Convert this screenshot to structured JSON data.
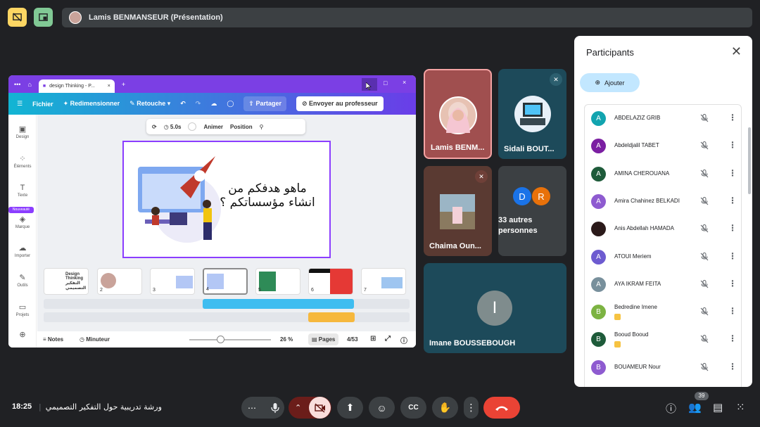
{
  "presenter_chip": {
    "label": "Lamis BENMANSEUR (Présentation)"
  },
  "canva": {
    "tab_title": "design Thinking - P...",
    "menu": {
      "file": "Fichier",
      "resize": "Redimensionner",
      "retouch": "Retouche",
      "share": "Partager",
      "send": "Envoyer au professeur"
    },
    "floatbar": {
      "duration": "5.0s",
      "animate": "Animer",
      "position": "Position"
    },
    "sidebar": [
      {
        "label": "Design",
        "icon": "design-icon"
      },
      {
        "label": "Éléments",
        "icon": "elements-icon"
      },
      {
        "label": "Texte",
        "icon": "text-icon"
      },
      {
        "label": "Marque",
        "icon": "brand-icon"
      },
      {
        "label": "Importer",
        "icon": "upload-icon"
      },
      {
        "label": "Outils",
        "icon": "tools-icon"
      },
      {
        "label": "Projets",
        "icon": "projects-icon"
      }
    ],
    "new_badge": "Nouveauté",
    "slide_text": "ماهو هدفكم من انشاء مؤسساتكم ؟",
    "thumbs": [
      {
        "num": "",
        "title": "Design Thinking التفكير التصميمي"
      },
      {
        "num": "2",
        "title": ""
      },
      {
        "num": "3",
        "title": ""
      },
      {
        "num": "4",
        "title": ""
      },
      {
        "num": "5",
        "title": ""
      },
      {
        "num": "6",
        "title": ""
      },
      {
        "num": "7",
        "title": ""
      }
    ],
    "footer": {
      "notes": "Notes",
      "timer": "Minuteur",
      "zoom": "26 %",
      "pages": "Pages",
      "page_count": "4/53"
    },
    "progress": 0.38
  },
  "tiles": {
    "lamis": "Lamis BENM...",
    "sidali": "Sidali BOUT...",
    "chaima": "Chaima Oun...",
    "others_label": "33 autres personnes",
    "others_avatars": [
      {
        "letter": "D",
        "color": "#1a73e8"
      },
      {
        "letter": "R",
        "color": "#e8710a"
      }
    ],
    "imane_initial": "I",
    "imane": "Imane BOUSSEBOUGH"
  },
  "panel": {
    "title": "Participants",
    "add_label": "Ajouter",
    "participants": [
      {
        "initial": "A",
        "name": "ABDELAZIZ GRIB",
        "color": "#12a4af",
        "badge": false
      },
      {
        "initial": "A",
        "name": "Abdeldjalil TABET",
        "color": "#7b1fa2",
        "badge": false
      },
      {
        "initial": "A",
        "name": "AMINA CHEROUANA",
        "color": "#1e5b3a",
        "badge": false
      },
      {
        "initial": "A",
        "name": "Amira Chahinez BELKADI",
        "color": "#8e5bd0",
        "badge": false
      },
      {
        "initial": "",
        "name": "Anis Abdellah HAMADA",
        "color": "#2b1a1a",
        "badge": false
      },
      {
        "initial": "A",
        "name": "ATOUI Meriem",
        "color": "#6d5bd0",
        "badge": false
      },
      {
        "initial": "A",
        "name": "AYA IKRAM FEITA",
        "color": "#78909c",
        "badge": false
      },
      {
        "initial": "B",
        "name": "Bedredine Imene",
        "color": "#7cb342",
        "badge": true
      },
      {
        "initial": "B",
        "name": "Booud Booud",
        "color": "#1e5b3a",
        "badge": true
      },
      {
        "initial": "B",
        "name": "BOUAMEUR Nour",
        "color": "#8e5bd0",
        "badge": false
      }
    ]
  },
  "bottom": {
    "time": "18:25",
    "meeting": "ورشة تدريبية حول التفكير التصميمي",
    "people_count": "39"
  }
}
